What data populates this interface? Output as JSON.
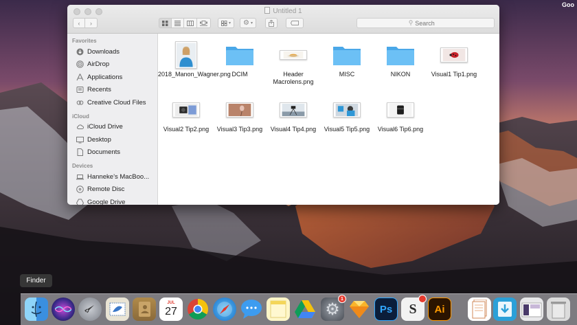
{
  "screen": {
    "top_right_label": "Goo"
  },
  "window": {
    "title": "Untitled 1",
    "search_placeholder": "Search"
  },
  "sidebar": {
    "sections": [
      {
        "label": "Favorites",
        "items": [
          {
            "label": "Downloads",
            "icon": "download-icon"
          },
          {
            "label": "AirDrop",
            "icon": "airdrop-icon"
          },
          {
            "label": "Applications",
            "icon": "applications-icon"
          },
          {
            "label": "Recents",
            "icon": "recents-icon"
          },
          {
            "label": "Creative Cloud Files",
            "icon": "creative-cloud-icon"
          }
        ]
      },
      {
        "label": "iCloud",
        "items": [
          {
            "label": "iCloud Drive",
            "icon": "cloud-icon"
          },
          {
            "label": "Desktop",
            "icon": "desktop-icon"
          },
          {
            "label": "Documents",
            "icon": "documents-icon"
          }
        ]
      },
      {
        "label": "Devices",
        "items": [
          {
            "label": "Hanneke’s MacBoo...",
            "icon": "laptop-icon"
          },
          {
            "label": "Remote Disc",
            "icon": "disc-icon"
          },
          {
            "label": "Google Drive",
            "icon": "drive-icon"
          }
        ]
      }
    ]
  },
  "files": [
    {
      "name": "2018_Manon_Wagner.png",
      "kind": "image"
    },
    {
      "name": "DCIM",
      "kind": "folder"
    },
    {
      "name": "Header Macrolens.png",
      "kind": "image"
    },
    {
      "name": "MISC",
      "kind": "folder"
    },
    {
      "name": "NIKON",
      "kind": "folder"
    },
    {
      "name": "Visual1 Tip1.png",
      "kind": "image"
    },
    {
      "name": "Visual2 Tip2.png",
      "kind": "image"
    },
    {
      "name": "Visual3 Tip3.png",
      "kind": "image"
    },
    {
      "name": "Visual4 Tip4.png",
      "kind": "image"
    },
    {
      "name": "Visual5 Tip5.png",
      "kind": "image"
    },
    {
      "name": "Visual6 Tip6.png",
      "kind": "image"
    }
  ],
  "dock": {
    "tooltip": "Finder",
    "calendar_month": "JUL",
    "calendar_day": "27",
    "photoshop_label": "Ps",
    "illustrator_label": "Ai",
    "system_prefs_badge": "1",
    "colors": {
      "folder": "#5eb6ef",
      "chrome_red": "#db4437",
      "chrome_yellow": "#f4c20d",
      "chrome_green": "#0f9d58",
      "chrome_blue": "#4285f4"
    }
  }
}
